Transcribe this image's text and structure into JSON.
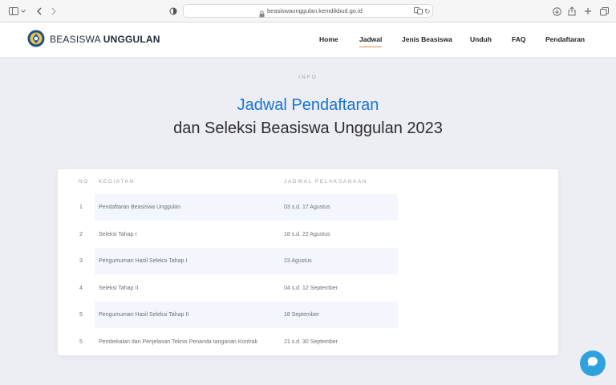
{
  "browser": {
    "url": "beasiswaunggulan.kemdikbud.go.id",
    "icons": [
      "sidebar-icon",
      "chevron-down-icon",
      "back-icon",
      "forward-icon",
      "shield-icon",
      "lock-icon",
      "translate-icon",
      "reload-icon",
      "download-icon",
      "share-icon",
      "plus-icon",
      "tabs-icon"
    ]
  },
  "nav": {
    "brand_light": "BEASISWA",
    "brand_bold": "UNGGULAN",
    "items": [
      {
        "label": "Home",
        "active": false
      },
      {
        "label": "Jadwal",
        "active": true
      },
      {
        "label": "Jenis Beasiswa",
        "active": false
      },
      {
        "label": "Unduh",
        "active": false
      },
      {
        "label": "FAQ",
        "active": false
      },
      {
        "label": "Pendaftaran",
        "active": false
      }
    ],
    "accent": "#e58a4d"
  },
  "hero": {
    "eyebrow": "INFO",
    "title": "Jadwal Pendaftaran",
    "subtitle": "dan Seleksi Beasiswa Unggulan 2023",
    "title_color": "#1a73d9"
  },
  "table": {
    "headers": {
      "no": "NO",
      "kegiatan": "KEGIATAN",
      "jadwal": "JADWAL PELAKSANAAN"
    },
    "rows": [
      {
        "no": "1",
        "kegiatan": "Pendaftaran Beasiswa Unggulan",
        "jadwal": "03 s.d. 17 Agustus"
      },
      {
        "no": "2",
        "kegiatan": "Seleksi Tahap I",
        "jadwal": "18 s.d. 22 Agustus"
      },
      {
        "no": "3",
        "kegiatan": "Pengumuman Hasil Seleksi Tahap I",
        "jadwal": "23 Agustus"
      },
      {
        "no": "4",
        "kegiatan": "Seleksi Tahap II",
        "jadwal": "04 s.d. 12 September"
      },
      {
        "no": "5",
        "kegiatan": "Pengumuman Hasil Seleksi Tahap II",
        "jadwal": "18 September"
      },
      {
        "no": "5",
        "kegiatan": "Pembekalan dan Penjelasan Teknis Penanda tanganan Kontrak",
        "jadwal": "21 s.d. 30 September"
      }
    ],
    "band_color": "#f3f7fd"
  },
  "chat": {
    "icon": "chat-icon",
    "color": "#2ea1de"
  }
}
